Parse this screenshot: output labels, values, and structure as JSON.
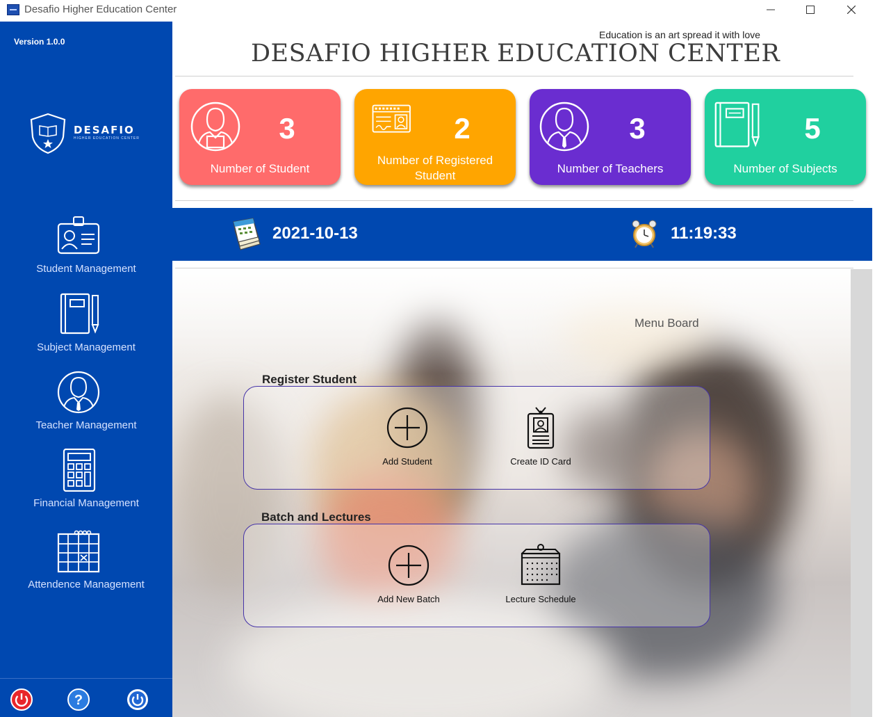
{
  "window": {
    "title": "Desafio Higher Education Center",
    "controls": [
      "minimize-icon",
      "maximize-icon",
      "close-icon"
    ]
  },
  "sidebar": {
    "version": "Version 1.0.0",
    "logo": {
      "name": "DESAFIO",
      "subtitle": "HIGHER EDUCATION CENTER"
    },
    "items": [
      {
        "label": "Student Management",
        "icon": "id-badge-icon"
      },
      {
        "label": "Subject Management",
        "icon": "notebook-icon"
      },
      {
        "label": "Teacher Management",
        "icon": "teacher-icon"
      },
      {
        "label": "Financial Management",
        "icon": "calculator-icon"
      },
      {
        "label": "Attendence Management",
        "icon": "calendar-icon"
      }
    ],
    "footer_buttons": [
      "power-off-icon",
      "help-icon",
      "logout-icon"
    ]
  },
  "header": {
    "tagline": "Education is an art spread it with love",
    "title": "DESAFIO HIGHER EDUCATION CENTER"
  },
  "stats": [
    {
      "count": "3",
      "label": "Number of Student",
      "color": "#ff6b6b",
      "icon": "student-icon"
    },
    {
      "count": "2",
      "label": "Number of  Registered Student",
      "color": "#ffa500",
      "icon": "registration-card-icon"
    },
    {
      "count": "3",
      "label": "Number of Teachers",
      "color": "#6a2dd0",
      "icon": "teacher-icon"
    },
    {
      "count": "5",
      "label": "Number of Subjects",
      "color": "#20d09f",
      "icon": "notebook-icon"
    }
  ],
  "datetime": {
    "date": "2021-10-13",
    "time": "11:19:33",
    "date_icon": "calendar-stack-icon",
    "time_icon": "alarm-clock-icon"
  },
  "menu_board": {
    "title": "Menu Board",
    "groups": [
      {
        "title": "Register Student",
        "actions": [
          {
            "label": "Add Student",
            "icon": "add-circle-icon"
          },
          {
            "label": "Create ID Card",
            "icon": "id-card-icon"
          }
        ]
      },
      {
        "title": "Batch and Lectures",
        "actions": [
          {
            "label": "Add New Batch",
            "icon": "add-circle-icon"
          },
          {
            "label": "Lecture Schedule",
            "icon": "schedule-board-icon"
          }
        ]
      }
    ]
  },
  "colors": {
    "sidebar": "#0048b0",
    "date_bar": "#0048b0",
    "group_border": "#4533a8"
  }
}
